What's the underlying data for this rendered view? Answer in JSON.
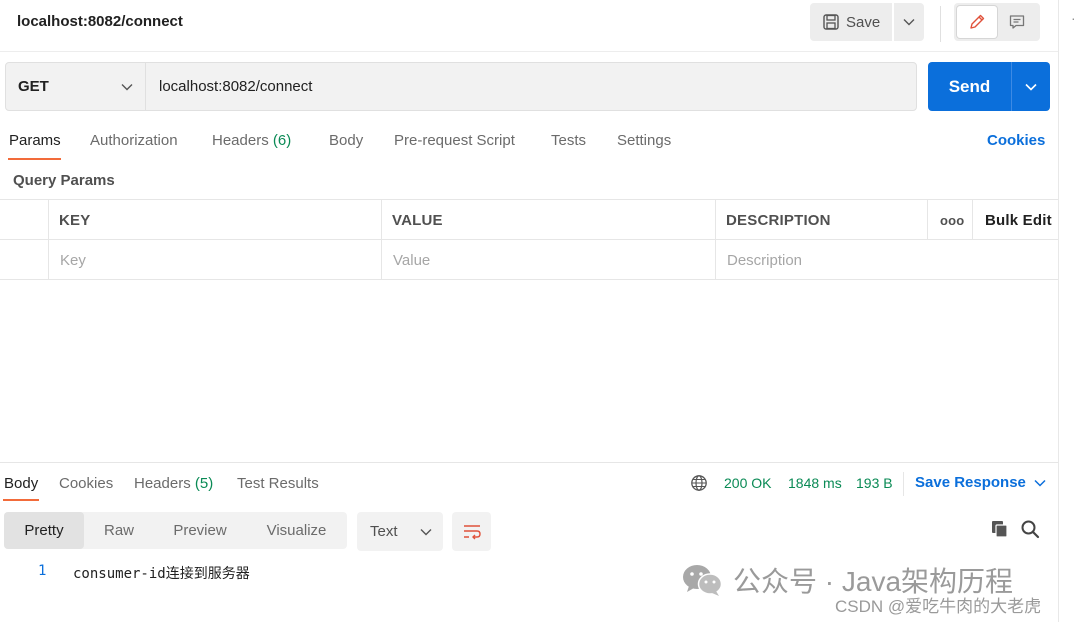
{
  "tab": {
    "title": "localhost:8082/connect"
  },
  "header": {
    "save_label": "Save"
  },
  "request": {
    "method": "GET",
    "url": "localhost:8082/connect",
    "send_label": "Send"
  },
  "req_tabs": {
    "params": "Params",
    "authorization": "Authorization",
    "headers": "Headers",
    "headers_count": "(6)",
    "body": "Body",
    "prerequest": "Pre-request Script",
    "tests": "Tests",
    "settings": "Settings",
    "cookies": "Cookies"
  },
  "query_params": {
    "title": "Query Params",
    "columns": {
      "key": "KEY",
      "value": "VALUE",
      "description": "DESCRIPTION",
      "more": "ooo",
      "bulk_edit": "Bulk Edit"
    },
    "placeholders": {
      "key": "Key",
      "value": "Value",
      "description": "Description"
    }
  },
  "response": {
    "tabs": {
      "body": "Body",
      "cookies": "Cookies",
      "headers": "Headers",
      "headers_count": "(5)",
      "test_results": "Test Results"
    },
    "status": "200 OK",
    "time": "1848 ms",
    "size": "193 B",
    "save_label": "Save Response",
    "views": [
      "Pretty",
      "Raw",
      "Preview",
      "Visualize"
    ],
    "format": "Text",
    "lines": [
      {
        "no": "1",
        "text": "consumer-id连接到服务器"
      }
    ]
  },
  "watermark": {
    "main": "公众号 · Java架构历程",
    "csdn": "CSDN @爱吃牛肉的大老虎"
  },
  "colors": {
    "accent": "#0b6fdb",
    "tab_indicator": "#f26b3a",
    "status_ok": "#0a8a55"
  }
}
